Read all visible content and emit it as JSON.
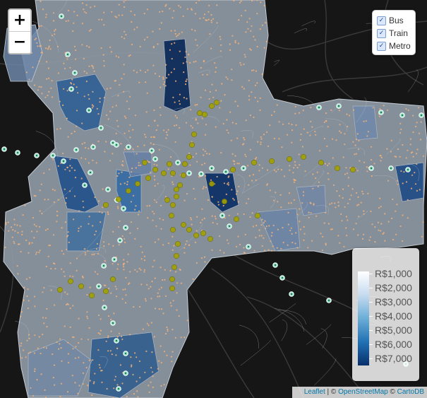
{
  "zoom": {
    "in_label": "+",
    "out_label": "−"
  },
  "layers": [
    {
      "label": "Bus",
      "checked": true
    },
    {
      "label": "Train",
      "checked": true
    },
    {
      "label": "Metro",
      "checked": true
    }
  ],
  "legend": {
    "labels": [
      "R$1,000",
      "R$2,000",
      "R$3,000",
      "R$4,000",
      "R$5,000",
      "R$6,000",
      "R$7,000"
    ],
    "gradient_colors": [
      "#ffffff",
      "#c6dbef",
      "#6baed6",
      "#2171b5",
      "#08306b"
    ]
  },
  "attribution": {
    "leaflet": "Leaflet",
    "sep1": " | © ",
    "osm": "OpenStreetMap",
    "sep2": " © ",
    "carto": "CartoDB"
  },
  "colors": {
    "background": "#161616",
    "city_base": "#8f9aa6",
    "bus_stops": "#f2b27a",
    "train_stations": "#8fe3c2",
    "metro_stations": "#a3a100"
  }
}
